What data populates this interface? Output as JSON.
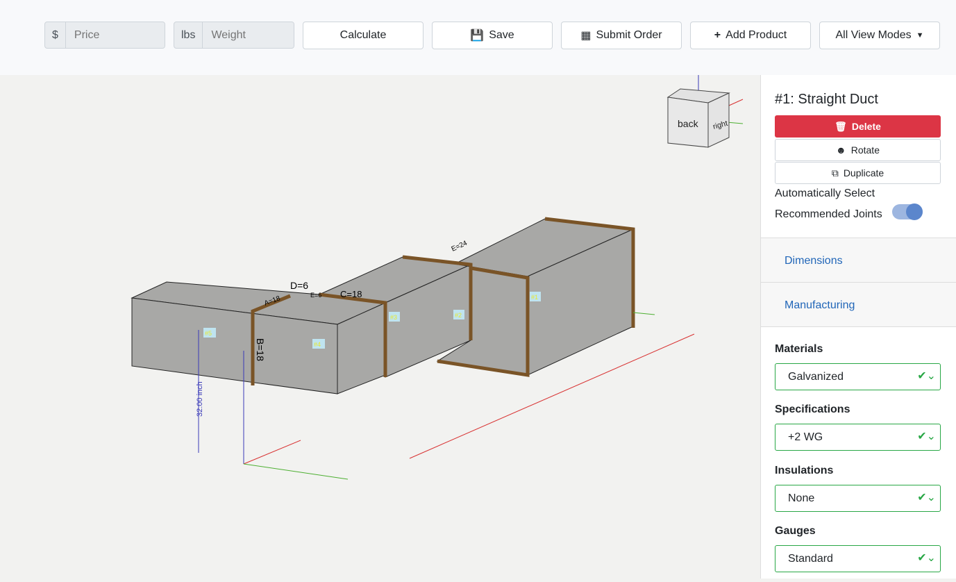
{
  "toolbar": {
    "price_prefix": "$",
    "price_placeholder": "Price",
    "weight_prefix": "lbs",
    "weight_placeholder": "Weight",
    "calculate": "Calculate",
    "save": "Save",
    "submit": "Submit Order",
    "add": "Add Product",
    "view_modes": "All View Modes"
  },
  "viewport": {
    "cube_back": "back",
    "cube_right": "right",
    "labels": {
      "d": "D=6",
      "e": "E=6",
      "c": "C=18",
      "a": "A=18",
      "b": "B=18",
      "e24": "E=24",
      "height": "32.00 inch"
    },
    "sections": [
      "#1",
      "#2",
      "#3",
      "#4",
      "#5"
    ]
  },
  "panel": {
    "title": "#1: Straight Duct",
    "delete": "Delete",
    "rotate": "Rotate",
    "duplicate": "Duplicate",
    "auto_line1": "Automatically Select",
    "auto_line2": "Recommended Joints",
    "auto_enabled": true,
    "dimensions": "Dimensions",
    "manufacturing": "Manufacturing",
    "fields": [
      {
        "label": "Materials",
        "value": "Galvanized"
      },
      {
        "label": "Specifications",
        "value": "+2 WG"
      },
      {
        "label": "Insulations",
        "value": "None"
      },
      {
        "label": "Gauges",
        "value": "Standard"
      }
    ]
  },
  "colors": {
    "danger": "#dc3545",
    "valid": "#28a745",
    "link": "#2166b8",
    "flange": "#7a5427"
  }
}
